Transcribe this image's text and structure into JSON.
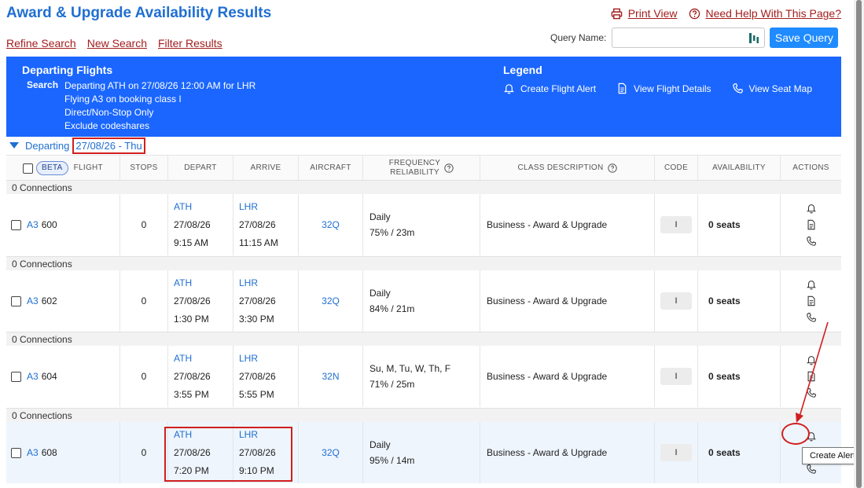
{
  "page": {
    "title": "Award & Upgrade Availability Results",
    "print_view": "Print View",
    "need_help": "Need Help With This Page?",
    "refine_search": "Refine Search",
    "new_search": "New Search",
    "filter_results": "Filter Results",
    "query_name_label": "Query Name:",
    "query_name_value": "",
    "save_query": "Save Query"
  },
  "banner": {
    "heading": "Departing Flights",
    "search_label": "Search",
    "search_lines": [
      "Departing ATH on 27/08/26 12:00 AM for LHR",
      "Flying A3 on booking class I",
      "Direct/Non-Stop Only",
      "Exclude codeshares"
    ],
    "legend_title": "Legend",
    "legend": {
      "alert": "Create Flight Alert",
      "details": "View Flight Details",
      "seat_map": "View Seat Map"
    }
  },
  "day": {
    "prefix": "Departing",
    "date": "27/08/26 - Thu"
  },
  "columns": {
    "beta": "BETA",
    "flight": "FLIGHT",
    "stops": "STOPS",
    "depart": "DEPART",
    "arrive": "ARRIVE",
    "aircraft": "AIRCRAFT",
    "frequency_1": "FREQUENCY",
    "frequency_2": "RELIABILITY",
    "class_description": "CLASS DESCRIPTION",
    "code": "CODE",
    "availability": "AVAILABILITY",
    "actions": "ACTIONS"
  },
  "flights": [
    {
      "connections": "0 Connections",
      "airline": "A3",
      "number": "600",
      "stops": "0",
      "dep_airport": "ATH",
      "dep_date": "27/08/26",
      "dep_time": "9:15 AM",
      "arr_airport": "LHR",
      "arr_date": "27/08/26",
      "arr_time": "11:15 AM",
      "aircraft": "32Q",
      "frequency": "Daily",
      "reliability": "75% / 23m",
      "class_description": "Business - Award & Upgrade",
      "code": "I",
      "availability": "0 seats"
    },
    {
      "connections": "0 Connections",
      "airline": "A3",
      "number": "602",
      "stops": "0",
      "dep_airport": "ATH",
      "dep_date": "27/08/26",
      "dep_time": "1:30 PM",
      "arr_airport": "LHR",
      "arr_date": "27/08/26",
      "arr_time": "3:30 PM",
      "aircraft": "32Q",
      "frequency": "Daily",
      "reliability": "84% / 21m",
      "class_description": "Business - Award & Upgrade",
      "code": "I",
      "availability": "0 seats"
    },
    {
      "connections": "0 Connections",
      "airline": "A3",
      "number": "604",
      "stops": "0",
      "dep_airport": "ATH",
      "dep_date": "27/08/26",
      "dep_time": "3:55 PM",
      "arr_airport": "LHR",
      "arr_date": "27/08/26",
      "arr_time": "5:55 PM",
      "aircraft": "32N",
      "frequency": "Su, M, Tu, W, Th, F",
      "reliability": "71% / 25m",
      "class_description": "Business - Award & Upgrade",
      "code": "I",
      "availability": "0 seats"
    },
    {
      "connections": "0 Connections",
      "airline": "A3",
      "number": "608",
      "stops": "0",
      "dep_airport": "ATH",
      "dep_date": "27/08/26",
      "dep_time": "7:20 PM",
      "arr_airport": "LHR",
      "arr_date": "27/08/26",
      "arr_time": "9:10 PM",
      "aircraft": "32Q",
      "frequency": "Daily",
      "reliability": "95% / 14m",
      "class_description": "Business - Award & Upgrade",
      "code": "I",
      "availability": "0 seats"
    }
  ],
  "tooltip": "Create Alert",
  "colors": {
    "accent": "#1a66ff",
    "link_red": "#a31d1d",
    "annotation": "#d11f1f",
    "highlight_row": "#eef5fd"
  }
}
